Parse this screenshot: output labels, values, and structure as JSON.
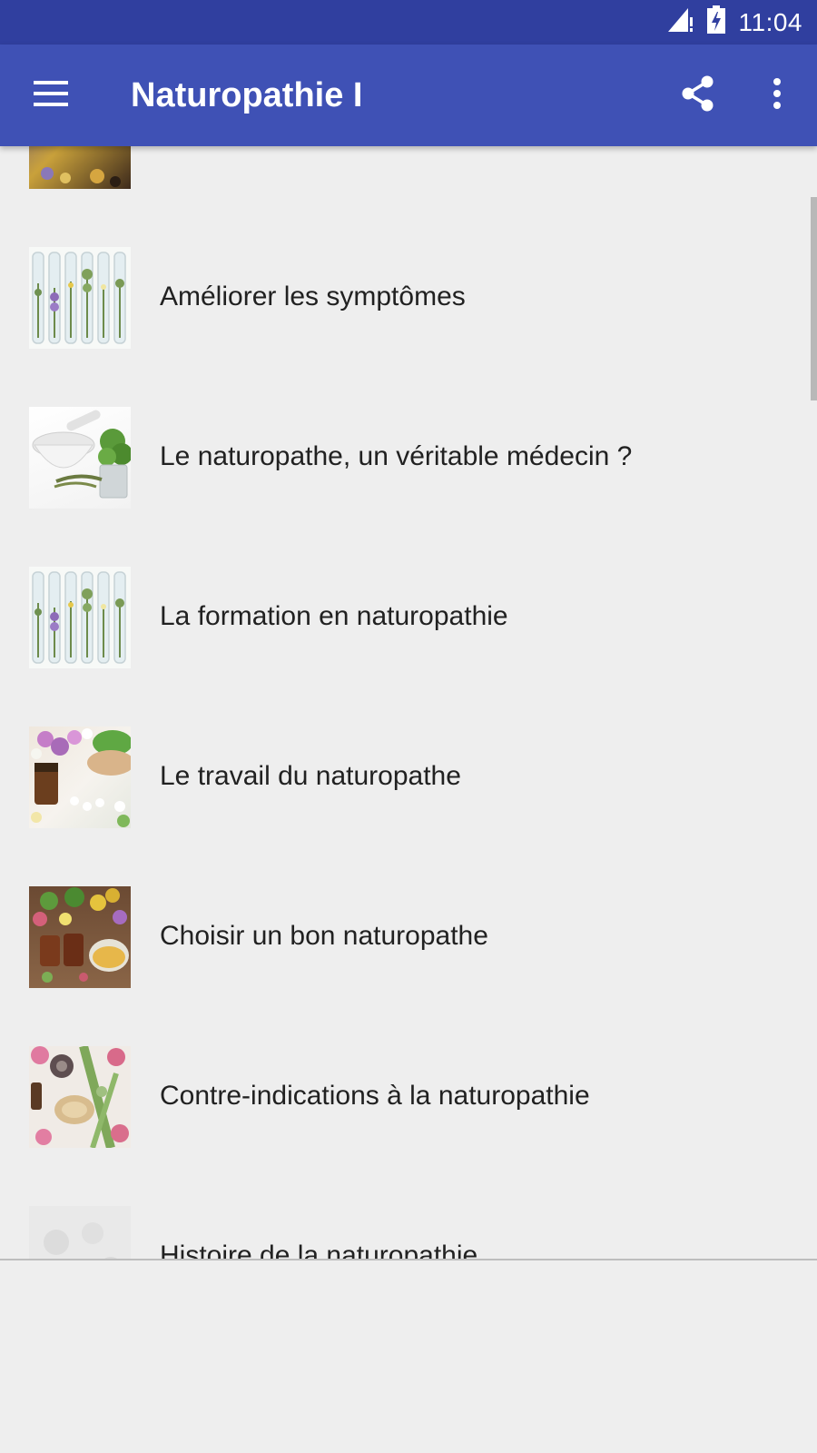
{
  "status_bar": {
    "time": "11:04",
    "icons": [
      "signal-alert-icon",
      "battery-charging-icon"
    ]
  },
  "app_bar": {
    "title": "Naturopathie I",
    "icons": [
      "menu-icon",
      "share-icon",
      "more-vert-icon"
    ]
  },
  "list": {
    "items": [
      {
        "label": "",
        "thumbnail": "dried-flowers-thumbnail"
      },
      {
        "label": "Améliorer les symptômes",
        "thumbnail": "herb-test-tubes-thumbnail"
      },
      {
        "label": "Le naturopathe, un véritable médecin ?",
        "thumbnail": "mortar-herbs-thumbnail"
      },
      {
        "label": "La formation en naturopathie",
        "thumbnail": "herb-test-tubes-thumbnail"
      },
      {
        "label": "Le travail du naturopathe",
        "thumbnail": "herbal-remedies-thumbnail"
      },
      {
        "label": "Choisir un bon naturopathe",
        "thumbnail": "flowers-tea-thumbnail"
      },
      {
        "label": "Contre-indications à la naturopathie",
        "thumbnail": "herbs-flatlay-thumbnail"
      },
      {
        "label": "Histoire de la naturopathie",
        "thumbnail": "faded-herbs-thumbnail"
      }
    ]
  },
  "colors": {
    "status_bar": "#303f9f",
    "app_bar": "#3f51b5",
    "background": "#eeeeee",
    "text": "#212121"
  }
}
